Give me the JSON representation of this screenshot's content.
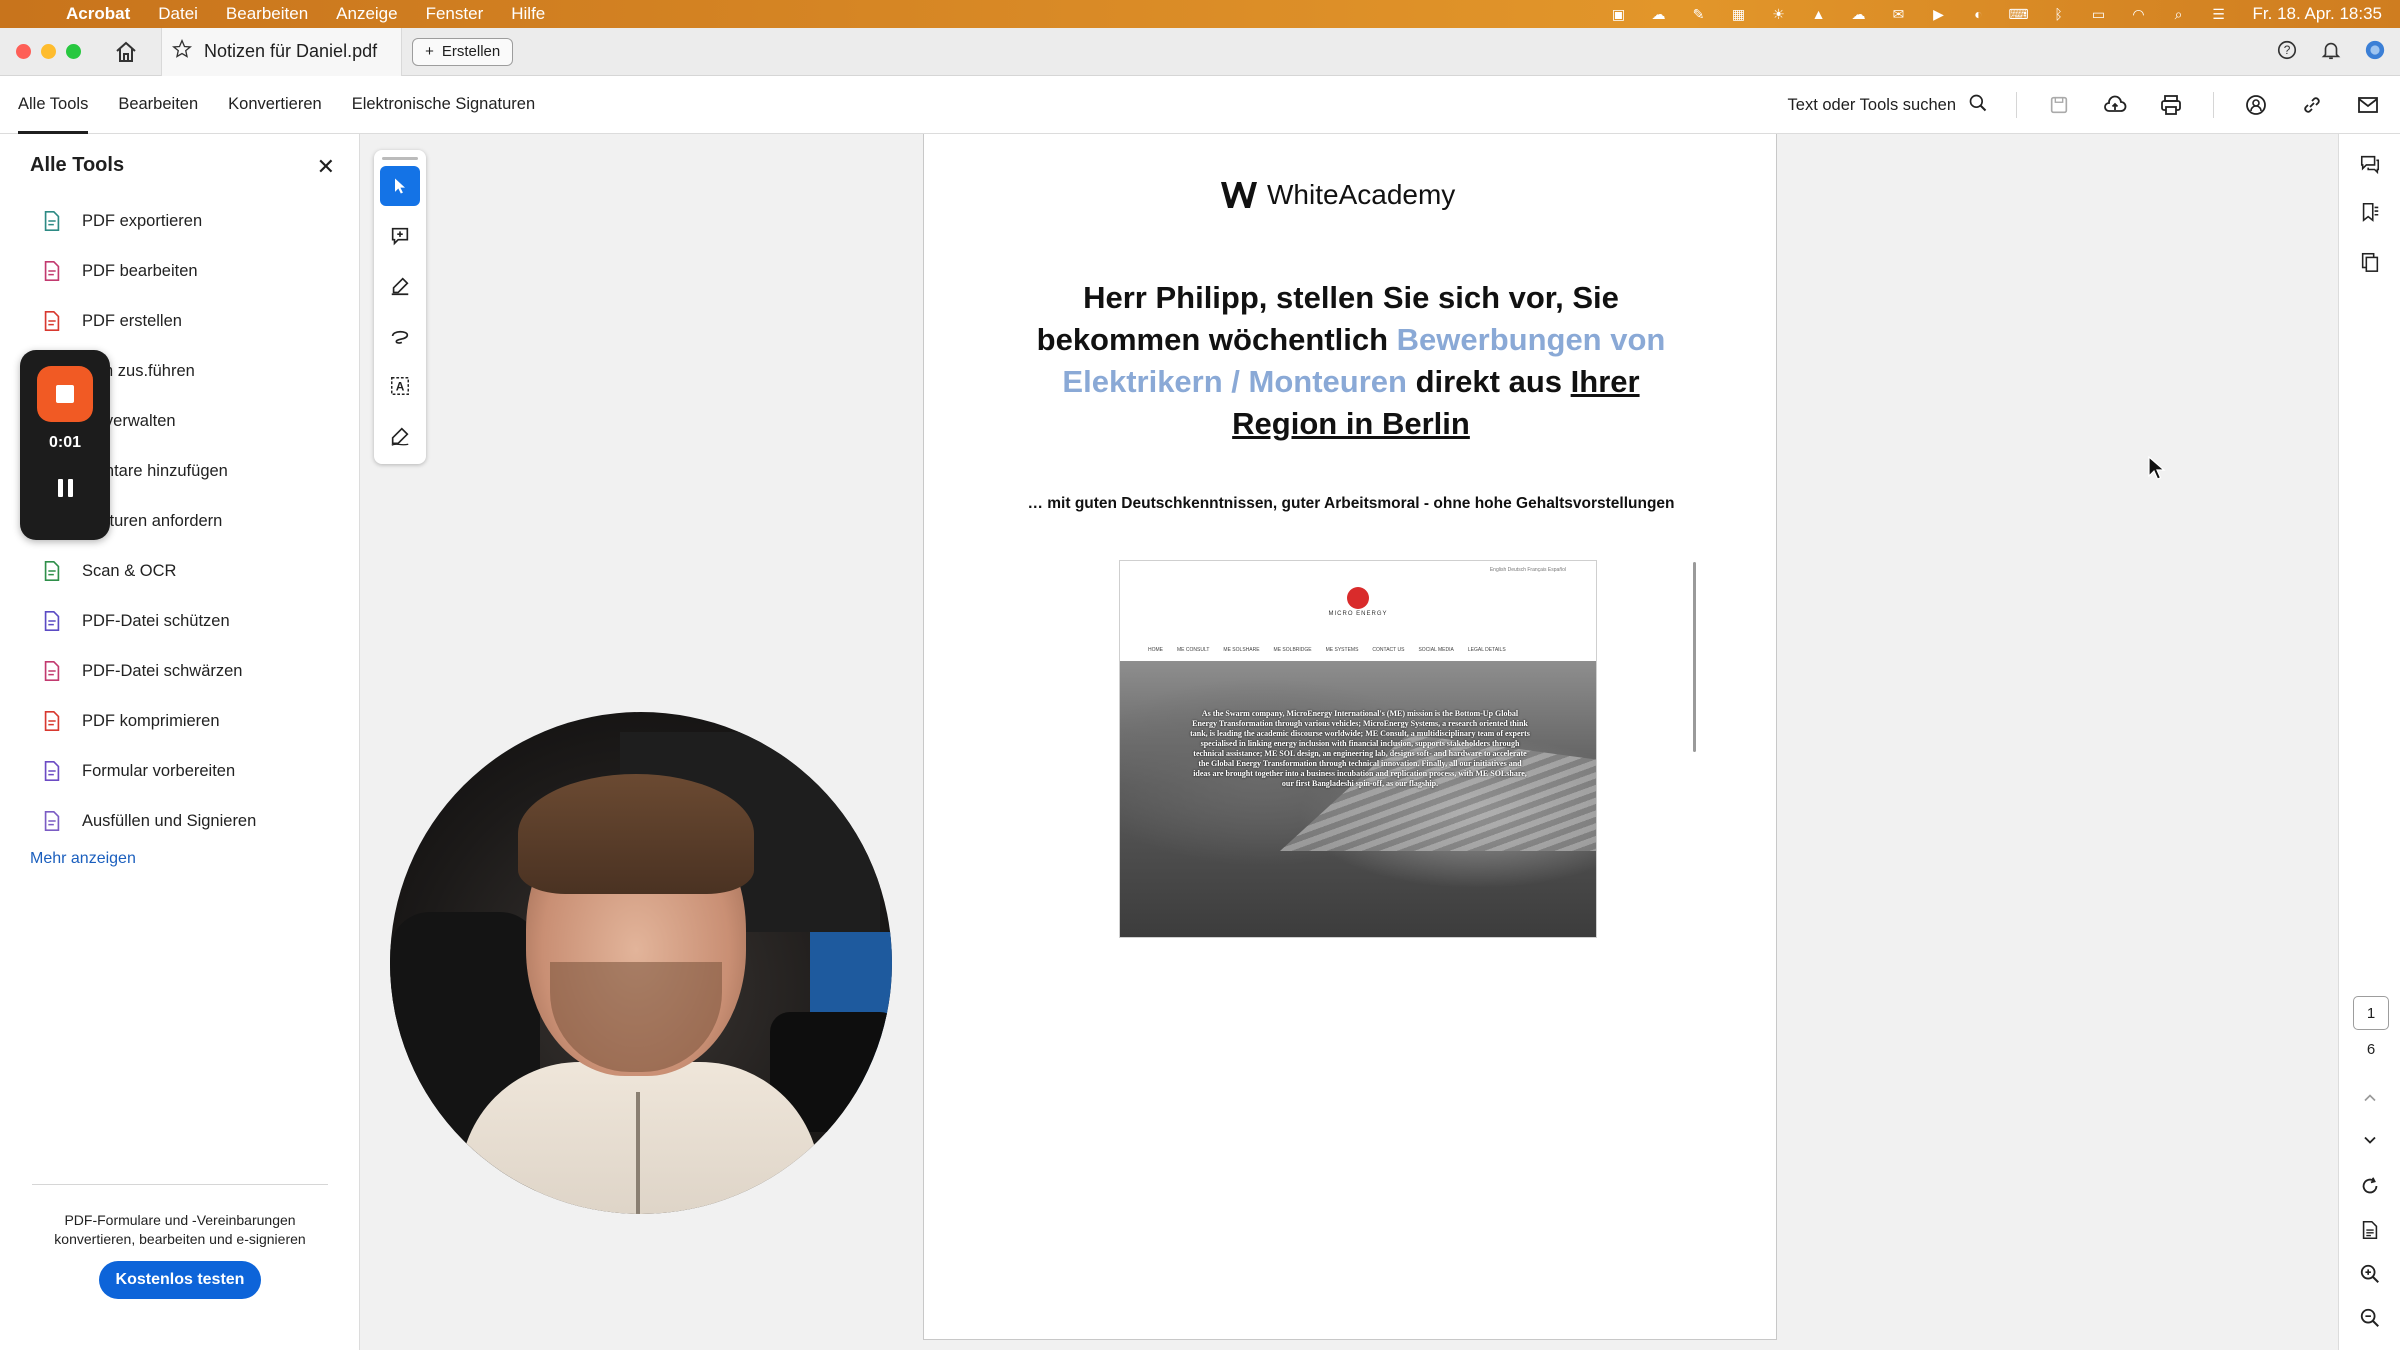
{
  "menubar": {
    "app": "Acrobat",
    "items": [
      "Datei",
      "Bearbeiten",
      "Anzeige",
      "Fenster",
      "Hilfe"
    ],
    "clock": "Fr. 18. Apr. 18:35"
  },
  "window": {
    "doc_title": "Notizen für Daniel.pdf",
    "create_label": "Erstellen"
  },
  "toolbar": {
    "tabs": [
      "Alle Tools",
      "Bearbeiten",
      "Konvertieren",
      "Elektronische Signaturen"
    ],
    "search_label": "Text oder Tools suchen"
  },
  "leftpanel": {
    "title": "Alle Tools",
    "items": [
      {
        "label": "PDF exportieren",
        "icon": "export-pdf-icon",
        "color": "#2d8a84"
      },
      {
        "label": "PDF bearbeiten",
        "icon": "edit-pdf-icon",
        "color": "#c23a6f"
      },
      {
        "label": "PDF erstellen",
        "icon": "create-pdf-icon",
        "color": "#d8382f"
      },
      {
        "label": "eien zus.führen",
        "icon": "combine-files-icon",
        "color": "#6c4bc4"
      },
      {
        "label": "en verwalten",
        "icon": "organize-pages-icon",
        "color": "#2f8f4a"
      },
      {
        "label": "mentare hinzufügen",
        "icon": "comment-icon",
        "color": "#e0a11a"
      },
      {
        "label": "gnaturen anfordern",
        "icon": "request-signatures-icon",
        "color": "#8c3fc0"
      },
      {
        "label": "Scan & OCR",
        "icon": "scan-ocr-icon",
        "color": "#2f8f4a"
      },
      {
        "label": "PDF-Datei schützen",
        "icon": "protect-pdf-icon",
        "color": "#5b4bc4"
      },
      {
        "label": "PDF-Datei schwärzen",
        "icon": "redact-pdf-icon",
        "color": "#c23a6f"
      },
      {
        "label": "PDF komprimieren",
        "icon": "compress-pdf-icon",
        "color": "#d8382f"
      },
      {
        "label": "Formular vorbereiten",
        "icon": "prepare-form-icon",
        "color": "#6c4bc4"
      },
      {
        "label": "Ausfüllen und Signieren",
        "icon": "fill-sign-icon",
        "color": "#7b5cc4"
      }
    ],
    "more": "Mehr anzeigen",
    "promo": "PDF-Formulare und -Vereinbarungen konvertieren, bearbeiten und e-signieren",
    "cta": "Kostenlos testen"
  },
  "recorder": {
    "time": "0:01"
  },
  "page": {
    "logo_text": "WhiteAcademy",
    "headline_part1": "Herr Philipp, stellen Sie sich vor, Sie bekommen wöchentlich ",
    "headline_blue": "Bewerbungen von Elektrikern / Monteuren",
    "headline_part2": " direkt aus ",
    "headline_underlined": "Ihrer Region in Berlin",
    "subline": "… mit guten Deutschkenntnissen, guter Arbeitsmoral - ohne hohe Gehaltsvorstellungen",
    "screenshot": {
      "lang_links": "English  Deutsch  Français  Español",
      "brand": "MICRO ENERGY",
      "menu": [
        "HOME",
        "ME CONSULT",
        "ME SOLSHARE",
        "ME SOLBRIDGE",
        "ME SYSTEMS",
        "CONTACT US",
        "SOCIAL MEDIA",
        "LEGAL DETAILS"
      ],
      "paragraph": "As the Swarm company, MicroEnergy International's (ME) mission is the Bottom-Up Global Energy Transformation through various vehicles; MicroEnergy Systems, a research oriented think tank, is leading the academic discourse worldwide; ME Consult, a multidisciplinary team of experts specialised in linking energy inclusion with financial inclusion, supports stakeholders through technical assistance; ME SOL design, an engineering lab, designs soft- and hardware to accelerate the Global Energy Transformation through technical innovation. Finally, all our initiatives and ideas are brought together into a business incubation and replication process, with ME SOLshare, our first Bangladeshi spin-off, as our flagship."
    }
  },
  "rightrail": {
    "current_page": "1",
    "total_pages": "6"
  },
  "colors": {
    "accent": "#1473e6",
    "cta": "#0d64d9",
    "headline_blue": "#8aa9d6",
    "record": "#f15a24"
  }
}
